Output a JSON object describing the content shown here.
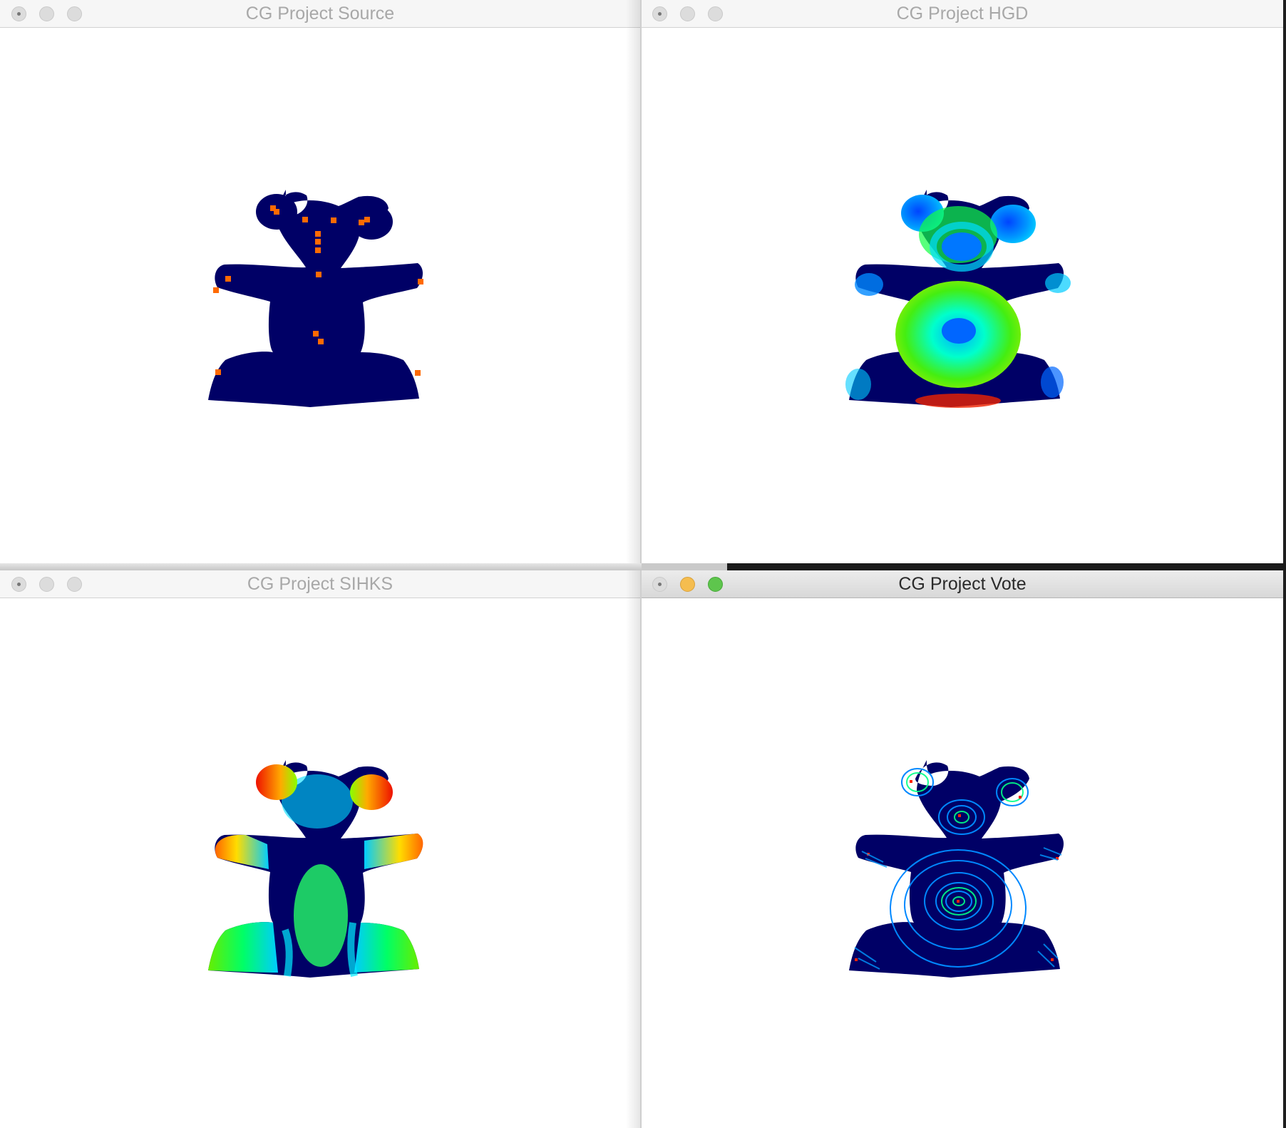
{
  "windows": [
    {
      "key": "source",
      "title": "CG Project Source",
      "active": false
    },
    {
      "key": "hgd",
      "title": "CG Project HGD",
      "active": false
    },
    {
      "key": "sihks",
      "title": "CG Project SIHKS",
      "active": false
    },
    {
      "key": "vote",
      "title": "CG Project Vote",
      "active": true
    }
  ],
  "colors": {
    "source_fill": "#000066",
    "source_markers": "#ff6a00",
    "vote_fill": "#0015ff"
  }
}
